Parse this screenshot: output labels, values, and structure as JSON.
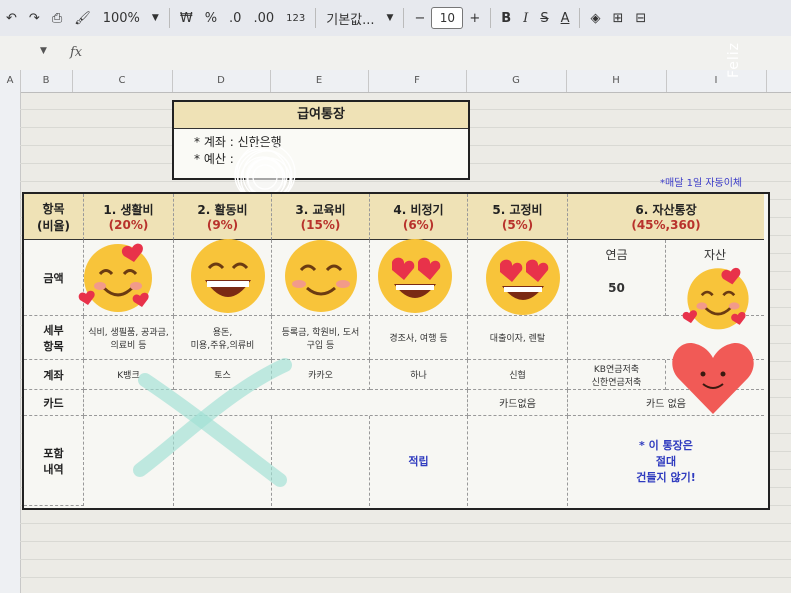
{
  "toolbar": {
    "zoom": "100%",
    "currency": "₩",
    "percent": "%",
    "dec_less": ".0",
    "dec_more": ".00",
    "number_format": "123",
    "font": "기본값...",
    "font_size": "10",
    "minus": "−",
    "plus": "+",
    "bold": "B",
    "italic": "I",
    "strike": "S",
    "text_color": "A"
  },
  "formula": {
    "name_box": "",
    "fx": "fx"
  },
  "columns": [
    "A",
    "B",
    "C",
    "D",
    "E",
    "F",
    "G",
    "H",
    "I"
  ],
  "title_box": {
    "title": "급여통장",
    "line1": "* 계좌 : 신한은행",
    "line2": "* 예산 :"
  },
  "note": "*매달 1일 자동이체",
  "table": {
    "row_labels": {
      "item": "항목\n(비율)",
      "amount": "금액",
      "detail": "세부\n항목",
      "account": "계좌",
      "card": "카드",
      "includes": "포함\n내역"
    },
    "categories": [
      {
        "name": "1. 생활비",
        "ratio": "(20%)",
        "detail": "식비, 생필품, 공과금,\n의료비 등",
        "account": "K뱅크"
      },
      {
        "name": "2. 활동비",
        "ratio": "(9%)",
        "detail": "용돈,\n미용,주유,의류비",
        "account": "토스"
      },
      {
        "name": "3. 교육비",
        "ratio": "(15%)",
        "detail": "등록금, 학원비, 도서\n구입 등",
        "account": "카카오"
      },
      {
        "name": "4. 비정기",
        "ratio": "(6%)",
        "detail": "경조사, 여행 등",
        "account": "하나",
        "includes": "적립"
      },
      {
        "name": "5. 고정비",
        "ratio": "(5%)",
        "detail": "대출이자, 렌탈",
        "account": "신협",
        "card": "카드없음"
      },
      {
        "name": "6. 자산통장",
        "ratio": "(45%,360)",
        "sub1": "연금",
        "sub2": "자산",
        "amount": "50",
        "account": "KB연금저축\n신한연금저축",
        "card": "카드 없음",
        "includes": "* 이 통장은\n절대\n건들지 않기!"
      }
    ]
  },
  "watermark": "Feliz"
}
